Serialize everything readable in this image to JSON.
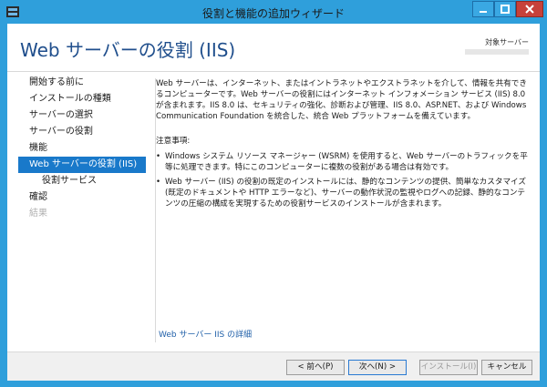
{
  "window": {
    "title": "役割と機能の追加ウィザード"
  },
  "header": {
    "page_title": "Web サーバーの役割 (IIS)",
    "target_label": "対象サーバー"
  },
  "nav": {
    "items": [
      {
        "label": "開始する前に",
        "state": "normal"
      },
      {
        "label": "インストールの種類",
        "state": "normal"
      },
      {
        "label": "サーバーの選択",
        "state": "normal"
      },
      {
        "label": "サーバーの役割",
        "state": "normal"
      },
      {
        "label": "機能",
        "state": "normal"
      },
      {
        "label": "Web サーバーの役割 (IIS)",
        "state": "active"
      },
      {
        "label": "役割サービス",
        "state": "sub"
      },
      {
        "label": "確認",
        "state": "normal"
      },
      {
        "label": "結果",
        "state": "disabled"
      }
    ]
  },
  "content": {
    "intro": "Web サーバーは、インターネット、またはイントラネットやエクストラネットを介して、情報を共有できるコンピューターです。Web サーバーの役割にはインターネット インフォメーション サービス (IIS) 8.0 が含まれます。IIS 8.0 は、セキュリティの強化、診断および管理、IIS 8.0、ASP.NET、および Windows Communication Foundation を統合した、統合 Web プラットフォームを備えています。",
    "notes_heading": "注意事項:",
    "notes": [
      "Windows システム リソース マネージャー (WSRM) を使用すると、Web サーバーのトラフィックを平等に処理できます。特にこのコンピューターに複数の役割がある場合は有効です。",
      "Web サーバー (IIS) の役割の既定のインストールには、静的なコンテンツの提供、簡単なカスタマイズ (既定のドキュメントや HTTP エラーなど)、サーバーの動作状況の監視やログへの記録、静的なコンテンツの圧縮の構成を実現するための役割サービスのインストールが含まれます。"
    ],
    "more_link": "Web サーバー IIS の詳細"
  },
  "footer": {
    "prev": "< 前へ(P)",
    "next": "次へ(N) >",
    "install": "インストール(I)",
    "cancel": "キャンセル"
  },
  "colors": {
    "frame": "#2f9fdb",
    "active_nav": "#1979ca",
    "title_blue": "#1f4e8c",
    "link": "#1f5fa8"
  }
}
